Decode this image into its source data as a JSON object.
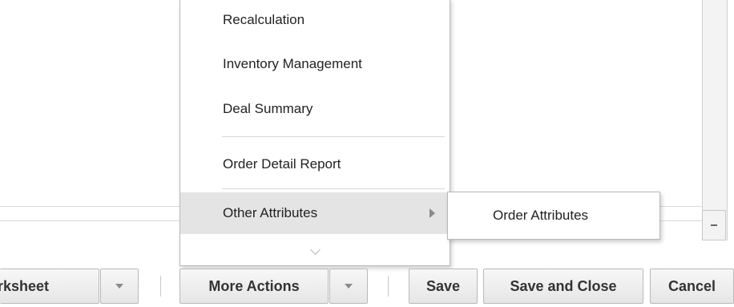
{
  "menu": {
    "items": [
      {
        "label": "Recalculation"
      },
      {
        "label": "Inventory Management"
      },
      {
        "label": "Deal Summary"
      },
      {
        "label": "Order Detail Report"
      },
      {
        "label": "Other Attributes",
        "has_submenu": true
      }
    ]
  },
  "submenu": {
    "items": [
      {
        "label": "Order Attributes"
      }
    ]
  },
  "toolbar": {
    "worksheet_label": "rksheet",
    "more_actions_label": "More Actions",
    "save_label": "Save",
    "save_close_label": "Save and Close",
    "cancel_label": "Cancel"
  }
}
